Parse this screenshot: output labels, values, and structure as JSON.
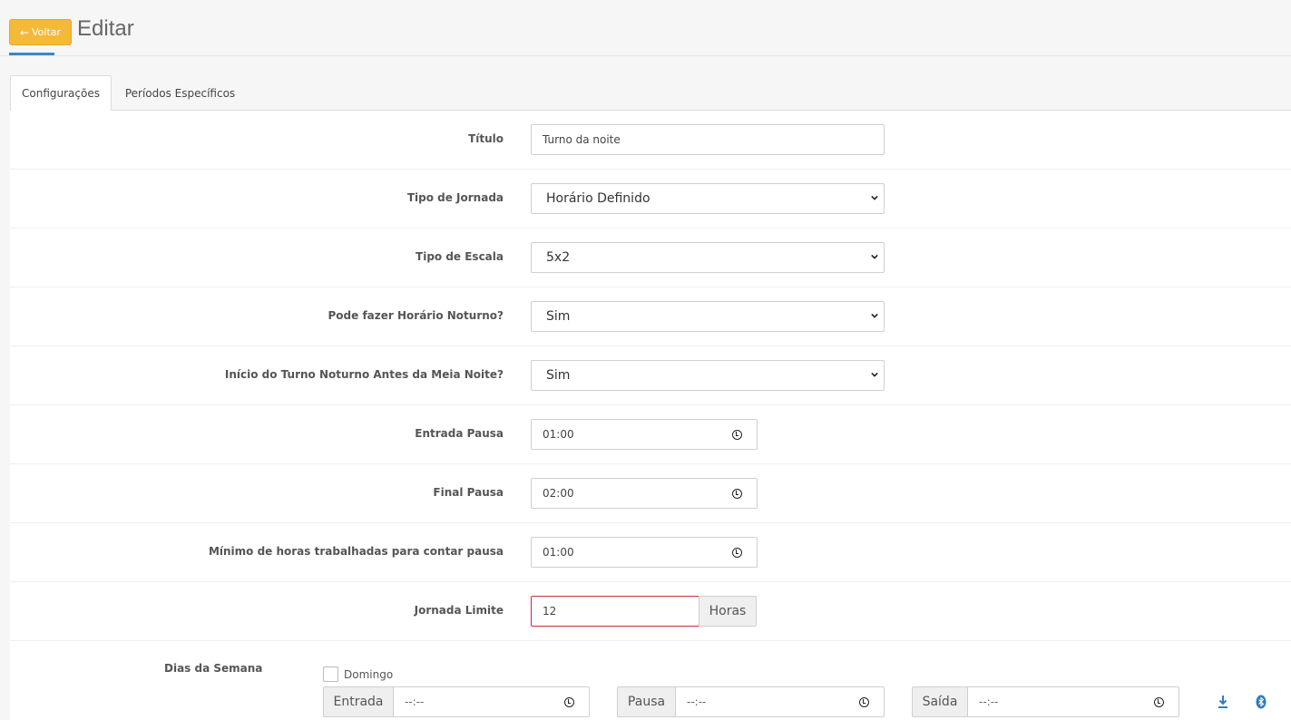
{
  "header": {
    "back_label": "Voltar",
    "title": "Editar"
  },
  "tabs": [
    {
      "label": "Configurações",
      "active": true
    },
    {
      "label": "Períodos Específicos",
      "active": false
    }
  ],
  "fields": {
    "titulo": {
      "label": "Título",
      "value": "Turno da noite"
    },
    "tipo_jornada": {
      "label": "Tipo de Jornada",
      "value": "Horário Definido"
    },
    "tipo_escala": {
      "label": "Tipo de Escala",
      "value": "5x2"
    },
    "horario_noturno": {
      "label": "Pode fazer Horário Noturno?",
      "value": "Sim"
    },
    "inicio_turno": {
      "label": "Início do Turno Noturno Antes da Meia Noite?",
      "value": "Sim"
    },
    "entrada_pausa": {
      "label": "Entrada Pausa",
      "value": "01:00"
    },
    "final_pausa": {
      "label": "Final Pausa",
      "value": "02:00"
    },
    "minimo_horas": {
      "label": "Mínimo de horas trabalhadas para contar pausa",
      "value": "01:00"
    },
    "jornada_limite": {
      "label": "Jornada Limite",
      "value": "12",
      "addon": "Horas"
    }
  },
  "dias_semana": {
    "label": "Dias da Semana",
    "day": "Domingo",
    "entrada_label": "Entrada",
    "entrada_value": "--:--",
    "pausa_label": "Pausa",
    "pausa_value": "--:--",
    "saida_label": "Saída",
    "saida_value": "--:--"
  },
  "colors": {
    "accent": "#f5b93a",
    "link": "#3b86c6",
    "error": "#c9302c"
  }
}
